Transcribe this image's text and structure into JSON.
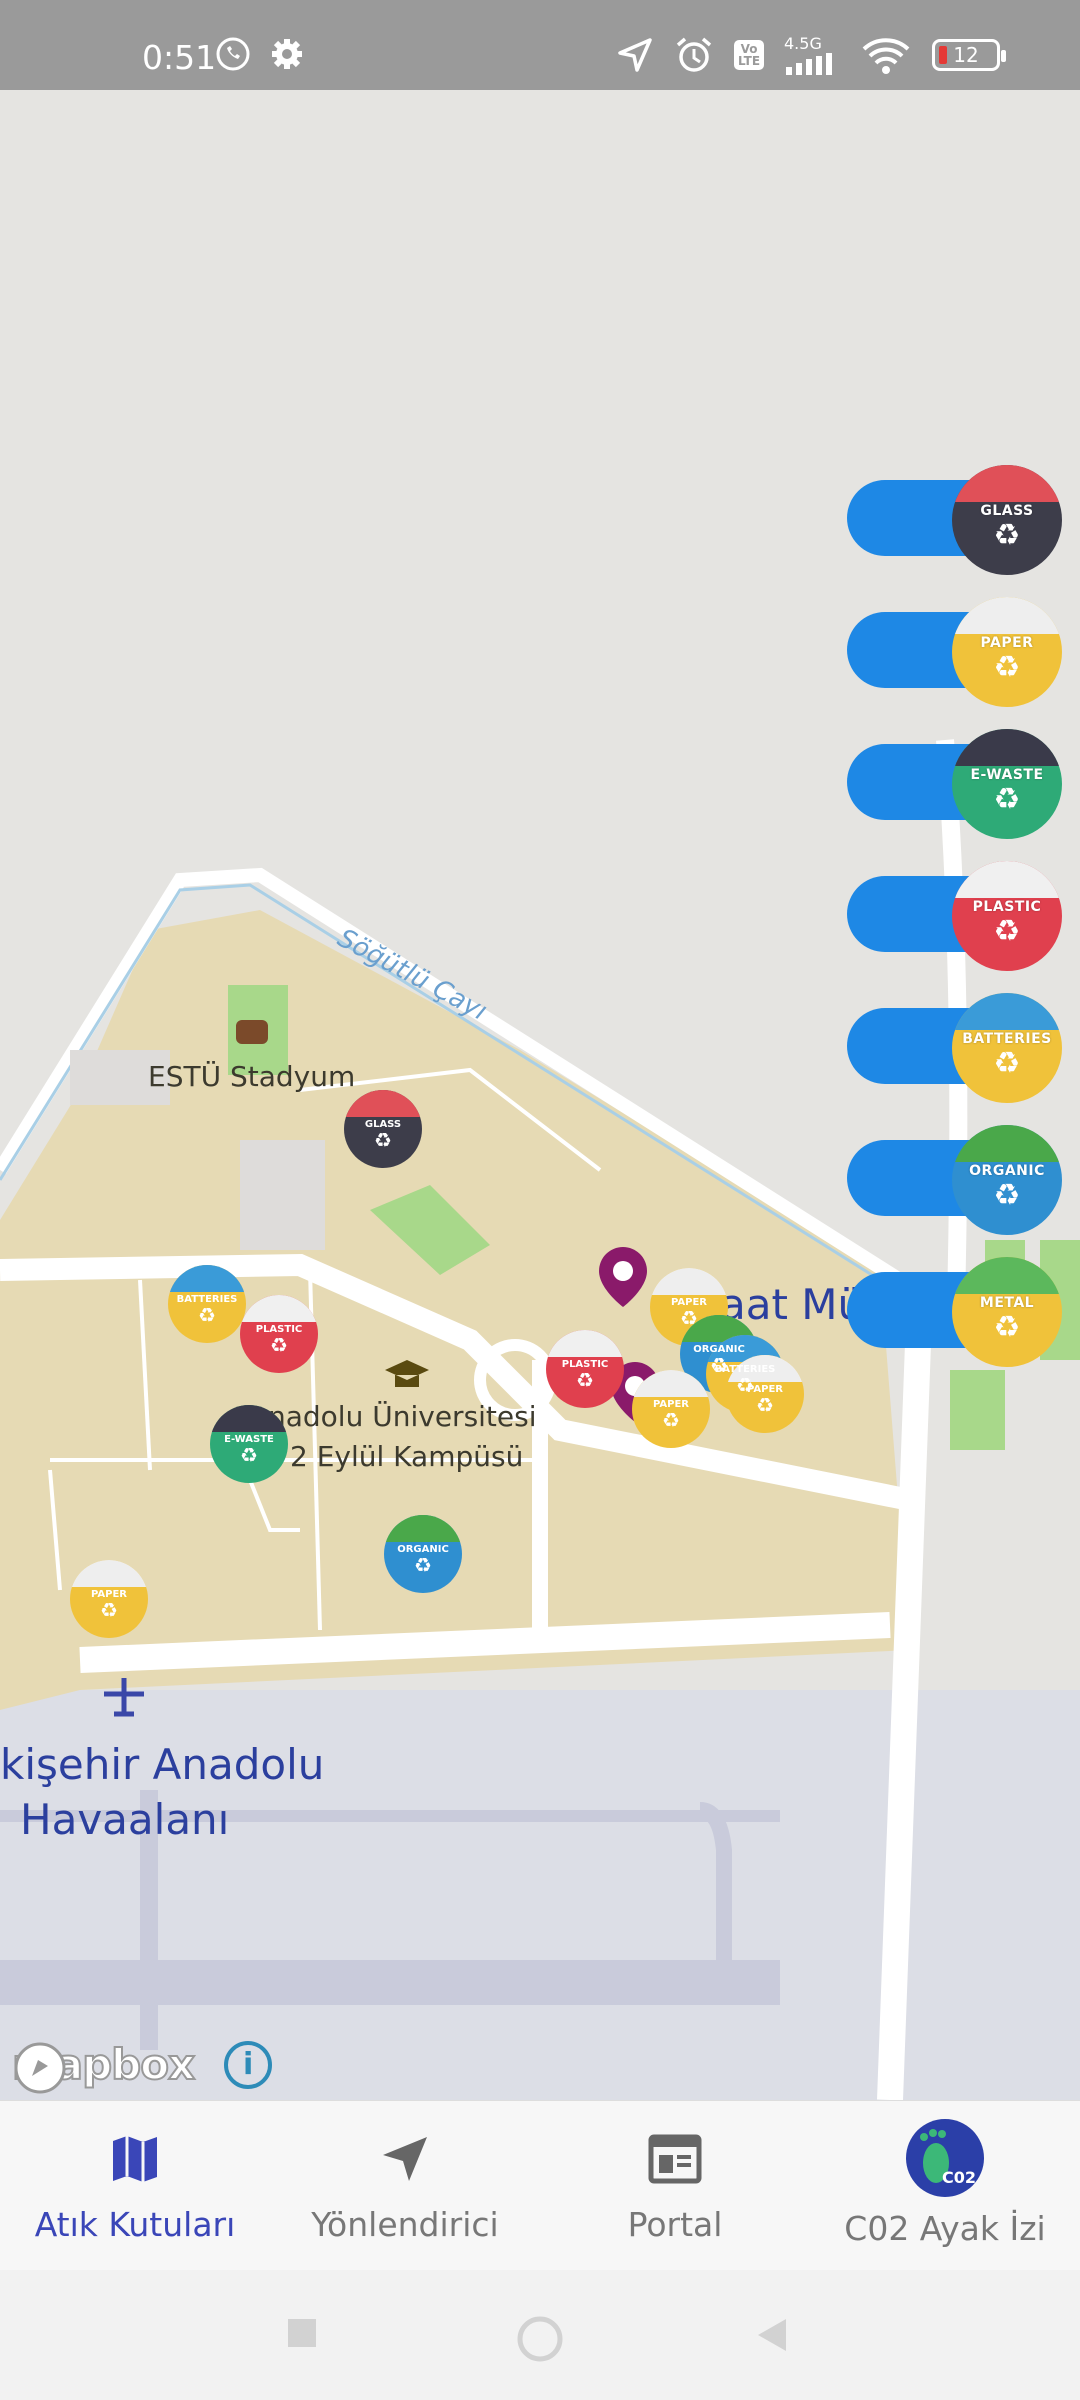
{
  "status_bar": {
    "time": "0:51",
    "network": "4.5G",
    "volte": "Vo LTE",
    "battery": "12"
  },
  "map": {
    "labels": {
      "stadium": "ESTÜ Stadyum",
      "campus_line1": "nadolu Üniversitesi",
      "campus_line2": "2 Eylül Kampüsü",
      "airport_line1": "kişehir Anadolu",
      "airport_line2": "Havaalanı",
      "river": "Söğütlü Çayı",
      "partial": "aat Mü"
    },
    "attribution": "mapbox",
    "info": "i"
  },
  "waste_types": [
    {
      "id": "glass",
      "label": "GLASS",
      "body": "#3d3d4a",
      "lid": "#e05058"
    },
    {
      "id": "paper",
      "label": "PAPER",
      "body": "#f0c23a",
      "lid": "#eeeeee"
    },
    {
      "id": "ewaste",
      "label": "E-WASTE",
      "body": "#2eaa77",
      "lid": "#3a3a4a"
    },
    {
      "id": "plastic",
      "label": "PLASTIC",
      "body": "#e0404e",
      "lid": "#f0f0f0"
    },
    {
      "id": "batteries",
      "label": "BATTERIES",
      "body": "#f0c23a",
      "lid": "#3a9bd8"
    },
    {
      "id": "organic",
      "label": "ORGANIC",
      "body": "#2f8fd0",
      "lid": "#4aa84a"
    },
    {
      "id": "metal",
      "label": "METAL",
      "body": "#f0c23a",
      "lid": "#5cb85c"
    }
  ],
  "bottom_nav": {
    "items": [
      {
        "label": "Atık Kutuları",
        "icon": "map-icon"
      },
      {
        "label": "Yönlendirici",
        "icon": "navigation-arrow-icon"
      },
      {
        "label": "Portal",
        "icon": "newspaper-icon"
      },
      {
        "label": "C02 Ayak İzi",
        "icon": "co2-footprint-icon",
        "badge": "C02"
      }
    ]
  }
}
